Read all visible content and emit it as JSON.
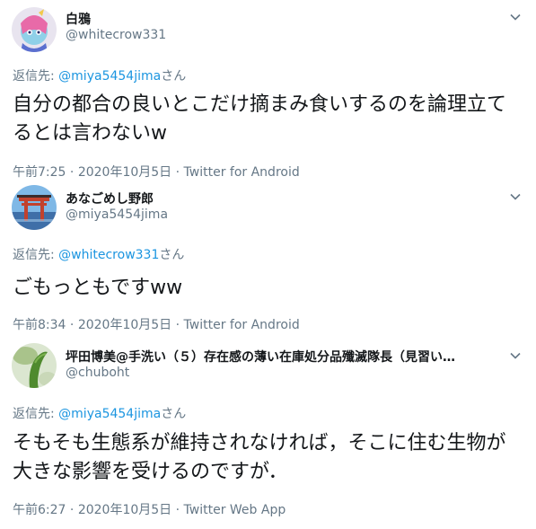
{
  "tweets": [
    {
      "name": "白鴉",
      "handle": "@whitecrow331",
      "reply_prefix": "返信先: ",
      "reply_to": "@miya5454jima",
      "reply_suffix": "さん",
      "text": "自分の都合の良いとこだけ摘まみ食いするのを論理立てるとは言わないw",
      "time": "午前7:25",
      "date": "2020年10月5日",
      "source": "Twitter for Android",
      "avatar_icon": "colorful-character-avatar"
    },
    {
      "name": "あなごめし野郎",
      "handle": "@miya5454jima",
      "reply_prefix": "返信先: ",
      "reply_to": "@whitecrow331",
      "reply_suffix": "さん",
      "text": "ごもっともですww",
      "time": "午前8:34",
      "date": "2020年10月5日",
      "source": "Twitter for Android",
      "avatar_icon": "torii-gate-avatar"
    },
    {
      "name": "坪田博美@手洗い（５）存在感の薄い在庫処分品殲滅隊長（見習い…",
      "handle": "@chuboht",
      "reply_prefix": "返信先: ",
      "reply_to": "@miya5454jima",
      "reply_suffix": "さん",
      "text": "そもそも生態系が維持されなければ，そこに住む生物が大きな影響を受けるのですが．",
      "time": "午前6:27",
      "date": "2020年10月5日",
      "source": "Twitter Web App",
      "avatar_icon": "green-plant-avatar"
    }
  ],
  "separator": " · "
}
